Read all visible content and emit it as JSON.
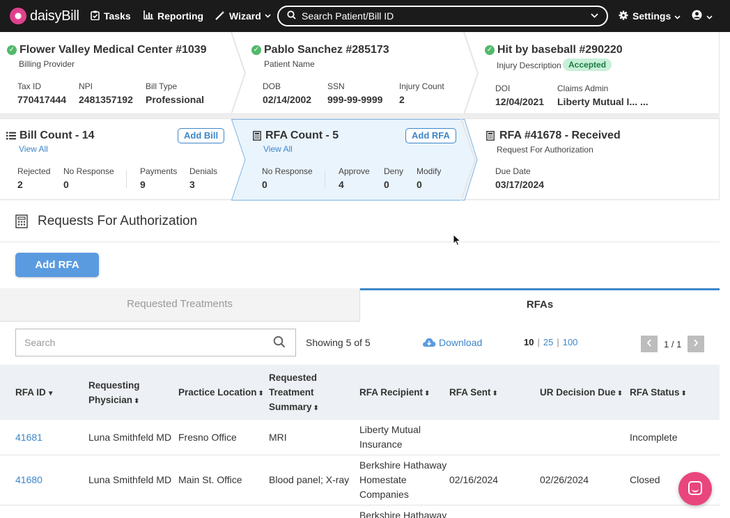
{
  "nav": {
    "logo": "daisyBill",
    "tasks": "Tasks",
    "reporting": "Reporting",
    "wizard": "Wizard",
    "search_placeholder": "Search Patient/Bill ID",
    "settings": "Settings"
  },
  "provider": {
    "title": "Flower Valley Medical Center #1039",
    "subtitle": "Billing Provider",
    "fields": [
      {
        "label": "Tax ID",
        "value": "770417444"
      },
      {
        "label": "NPI",
        "value": "2481357192"
      },
      {
        "label": "Bill Type",
        "value": "Professional"
      }
    ]
  },
  "patient": {
    "title": "Pablo Sanchez #285173",
    "subtitle": "Patient Name",
    "fields": [
      {
        "label": "DOB",
        "value": "02/14/2002"
      },
      {
        "label": "SSN",
        "value": "999-99-9999"
      },
      {
        "label": "Injury Count",
        "value": "2"
      }
    ]
  },
  "injury": {
    "title": "Hit by baseball #290220",
    "subtitle": "Injury Description",
    "badge": "Accepted",
    "fields": [
      {
        "label": "DOI",
        "value": "12/04/2021"
      },
      {
        "label": "Claims Admin",
        "value": "Liberty Mutual I... ..."
      }
    ]
  },
  "bills": {
    "title": "Bill Count - 14",
    "view_all": "View All",
    "add_button": "Add Bill",
    "fields": [
      {
        "label": "Rejected",
        "value": "2"
      },
      {
        "label": "No Response",
        "value": "0"
      },
      {
        "label": "Payments",
        "value": "9"
      },
      {
        "label": "Denials",
        "value": "3"
      }
    ]
  },
  "rfa_count": {
    "title": "RFA Count - 5",
    "view_all": "View All",
    "add_button": "Add RFA",
    "fields": [
      {
        "label": "No Response",
        "value": "0"
      },
      {
        "label": "Approve",
        "value": "4"
      },
      {
        "label": "Deny",
        "value": "0"
      },
      {
        "label": "Modify",
        "value": "0"
      }
    ]
  },
  "rfa_current": {
    "title": "RFA #41678 - Received",
    "subtitle": "Request For Authorization",
    "fields": [
      {
        "label": "Due Date",
        "value": "03/17/2024"
      }
    ]
  },
  "section": {
    "title": "Requests For Authorization",
    "add_button": "Add RFA"
  },
  "tabs": [
    {
      "label": "Requested Treatments",
      "active": false
    },
    {
      "label": "RFAs",
      "active": true
    }
  ],
  "toolbar": {
    "search_placeholder": "Search",
    "showing": "Showing 5 of 5",
    "download": "Download",
    "page_sizes": [
      "10",
      "25",
      "100"
    ],
    "active_page_size": "10",
    "page_label": "1 / 1"
  },
  "table": {
    "headers": [
      {
        "lines": [
          "RFA ID"
        ],
        "sort": "▼"
      },
      {
        "lines": [
          "Requesting",
          "Physician"
        ],
        "sort": "⬍"
      },
      {
        "lines": [
          "Practice Location"
        ],
        "sort": "⬍"
      },
      {
        "lines": [
          "Requested",
          "Treatment",
          "Summary"
        ],
        "sort": "⬍"
      },
      {
        "lines": [
          "RFA Recipient"
        ],
        "sort": "⬍"
      },
      {
        "lines": [
          "RFA Sent"
        ],
        "sort": "⬍"
      },
      {
        "lines": [
          "UR Decision Due"
        ],
        "sort": "⬍"
      },
      {
        "lines": [
          "RFA Status"
        ],
        "sort": "⬍"
      }
    ],
    "rows": [
      {
        "id": "41681",
        "physician": "Luna Smithfeld MD",
        "location": "Fresno Office",
        "summary": "MRI",
        "recipient": [
          "Liberty Mutual",
          "Insurance"
        ],
        "sent": "",
        "ur_due": "",
        "status": "Incomplete"
      },
      {
        "id": "41680",
        "physician": "Luna Smithfeld MD",
        "location": "Main St. Office",
        "summary": "Blood panel; X-ray",
        "recipient": [
          "Berkshire Hathaway",
          "Homestate",
          "Companies"
        ],
        "sent": "02/16/2024",
        "ur_due": "02/26/2024",
        "status": "Closed"
      },
      {
        "id": "",
        "physician": "",
        "location": "",
        "summary": "",
        "recipient": [
          "Berkshire Hathaway"
        ],
        "sent": "",
        "ur_due": "",
        "status": ""
      }
    ]
  },
  "colors": {
    "nav_bg": "#1b1b1b",
    "accent": "#3d86c9",
    "button_primary": "#5a9be0",
    "success": "#52b96a",
    "chat": "#e8467c"
  }
}
